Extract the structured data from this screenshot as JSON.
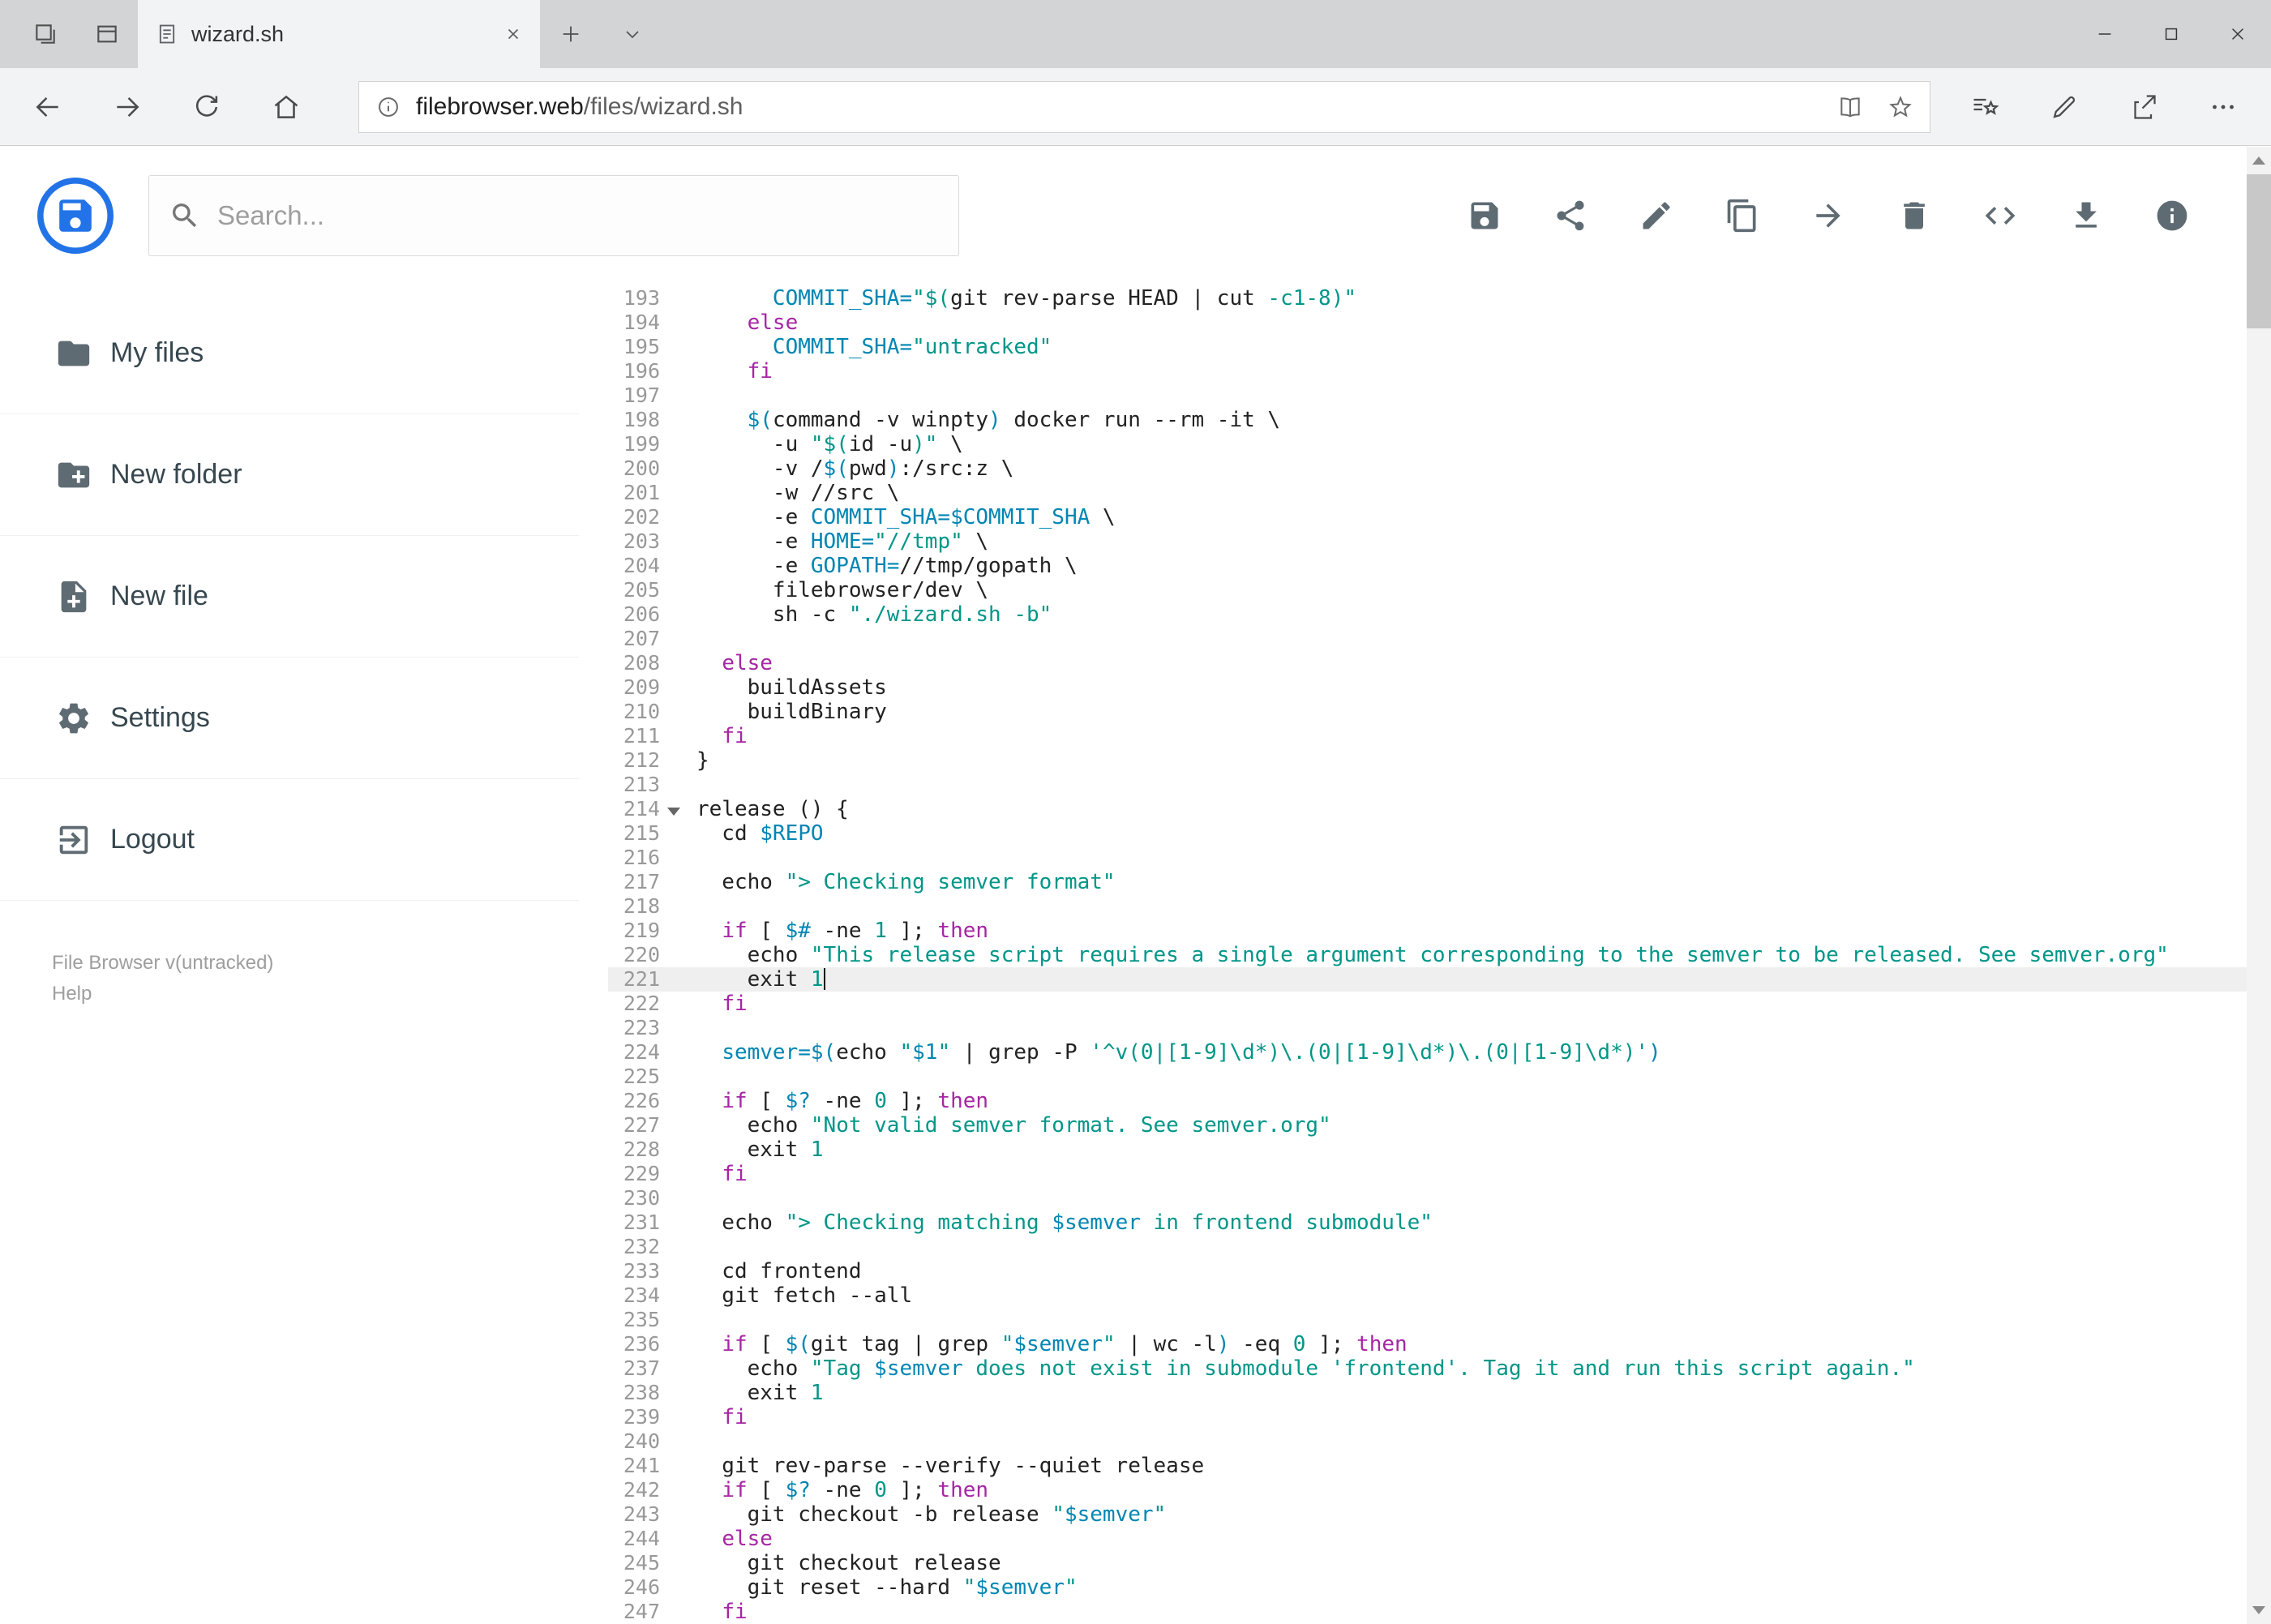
{
  "browser": {
    "tab_title": "wizard.sh",
    "url_host": "filebrowser.web",
    "url_path": "/files/wizard.sh",
    "icons": {
      "tabstrip_left": [
        "set-tabs-aside",
        "show-set-aside-tabs"
      ],
      "tab": [
        "page-favicon",
        "close-tab"
      ],
      "tabstrip_right": [
        "new-tab",
        "tab-preview-chevron"
      ],
      "window_controls": [
        "minimize",
        "maximize",
        "close"
      ],
      "nav": [
        "back",
        "forward",
        "refresh",
        "home"
      ],
      "url_field": [
        "info",
        "reading-view",
        "favorite-star"
      ],
      "toolbar_right": [
        "hub-favorites",
        "web-notes-pen",
        "share",
        "more-ellipsis"
      ]
    }
  },
  "app": {
    "search_placeholder": "Search...",
    "toolbar_icons": [
      "save",
      "share",
      "rename",
      "copy",
      "move",
      "delete",
      "code",
      "download",
      "info"
    ],
    "sidebar": {
      "items": [
        {
          "icon": "folder",
          "label": "My files"
        },
        {
          "icon": "new-folder",
          "label": "New folder"
        },
        {
          "icon": "new-file",
          "label": "New file"
        },
        {
          "icon": "settings",
          "label": "Settings"
        },
        {
          "icon": "logout",
          "label": "Logout"
        }
      ],
      "footer_version": "File Browser v(untracked)",
      "footer_help": "Help"
    }
  },
  "colors": {
    "brand": "#2273e8",
    "icon_gray": "#5f6b73",
    "code_plain": "#222222",
    "code_keyword": "#a626a4",
    "code_string": "#009688",
    "code_variable": "#0086b3",
    "code_number": "#009688",
    "line_number": "#999999",
    "active_line_bg": "#efefef"
  },
  "editor": {
    "language": "shell",
    "active_line": 221,
    "fold_marker_line": 214,
    "lines": [
      {
        "n": 193,
        "seg": [
          [
            "p",
            "      "
          ],
          [
            "v",
            "COMMIT_SHA="
          ],
          [
            "s",
            "\"$("
          ],
          [
            "p",
            "git rev-parse HEAD | cut "
          ],
          [
            "n",
            "-c1-8"
          ],
          [
            "s",
            ")\""
          ]
        ]
      },
      {
        "n": 194,
        "seg": [
          [
            "p",
            "    "
          ],
          [
            "k",
            "else"
          ]
        ]
      },
      {
        "n": 195,
        "seg": [
          [
            "p",
            "      "
          ],
          [
            "v",
            "COMMIT_SHA="
          ],
          [
            "s",
            "\"untracked\""
          ]
        ]
      },
      {
        "n": 196,
        "seg": [
          [
            "p",
            "    "
          ],
          [
            "k",
            "fi"
          ]
        ]
      },
      {
        "n": 197,
        "seg": []
      },
      {
        "n": 198,
        "seg": [
          [
            "p",
            "    "
          ],
          [
            "v",
            "$("
          ],
          [
            "p",
            "command -v winpty"
          ],
          [
            "v",
            ")"
          ],
          [
            "p",
            " docker run --rm -it \\"
          ]
        ]
      },
      {
        "n": 199,
        "seg": [
          [
            "p",
            "      -u "
          ],
          [
            "s",
            "\"$("
          ],
          [
            "p",
            "id -u"
          ],
          [
            "s",
            ")\""
          ],
          [
            "p",
            " \\"
          ]
        ]
      },
      {
        "n": 200,
        "seg": [
          [
            "p",
            "      -v /"
          ],
          [
            "v",
            "$("
          ],
          [
            "p",
            "pwd"
          ],
          [
            "v",
            ")"
          ],
          [
            "p",
            ":/src:z \\"
          ]
        ]
      },
      {
        "n": 201,
        "seg": [
          [
            "p",
            "      -w //src \\"
          ]
        ]
      },
      {
        "n": 202,
        "seg": [
          [
            "p",
            "      -e "
          ],
          [
            "v",
            "COMMIT_SHA=$COMMIT_SHA"
          ],
          [
            "p",
            " \\"
          ]
        ]
      },
      {
        "n": 203,
        "seg": [
          [
            "p",
            "      -e "
          ],
          [
            "v",
            "HOME="
          ],
          [
            "s",
            "\"//tmp\""
          ],
          [
            "p",
            " \\"
          ]
        ]
      },
      {
        "n": 204,
        "seg": [
          [
            "p",
            "      -e "
          ],
          [
            "v",
            "GOPATH="
          ],
          [
            "p",
            "//tmp/gopath \\"
          ]
        ]
      },
      {
        "n": 205,
        "seg": [
          [
            "p",
            "      filebrowser/dev \\"
          ]
        ]
      },
      {
        "n": 206,
        "seg": [
          [
            "p",
            "      sh -c "
          ],
          [
            "s",
            "\"./wizard.sh -b\""
          ]
        ]
      },
      {
        "n": 207,
        "seg": []
      },
      {
        "n": 208,
        "seg": [
          [
            "p",
            "  "
          ],
          [
            "k",
            "else"
          ]
        ]
      },
      {
        "n": 209,
        "seg": [
          [
            "p",
            "    buildAssets"
          ]
        ]
      },
      {
        "n": 210,
        "seg": [
          [
            "p",
            "    buildBinary"
          ]
        ]
      },
      {
        "n": 211,
        "seg": [
          [
            "p",
            "  "
          ],
          [
            "k",
            "fi"
          ]
        ]
      },
      {
        "n": 212,
        "seg": [
          [
            "p",
            "}"
          ]
        ]
      },
      {
        "n": 213,
        "seg": []
      },
      {
        "n": 214,
        "seg": [
          [
            "p",
            "release () {"
          ]
        ]
      },
      {
        "n": 215,
        "seg": [
          [
            "p",
            "  cd "
          ],
          [
            "v",
            "$REPO"
          ]
        ]
      },
      {
        "n": 216,
        "seg": []
      },
      {
        "n": 217,
        "seg": [
          [
            "p",
            "  echo "
          ],
          [
            "s",
            "\"> Checking semver format\""
          ]
        ]
      },
      {
        "n": 218,
        "seg": []
      },
      {
        "n": 219,
        "seg": [
          [
            "p",
            "  "
          ],
          [
            "k",
            "if"
          ],
          [
            "p",
            " [ "
          ],
          [
            "v",
            "$#"
          ],
          [
            "p",
            " -ne "
          ],
          [
            "n",
            "1"
          ],
          [
            "p",
            " ]; "
          ],
          [
            "k",
            "then"
          ]
        ]
      },
      {
        "n": 220,
        "seg": [
          [
            "p",
            "    echo "
          ],
          [
            "s",
            "\"This release script requires a single argument corresponding to the semver to be released. See semver.org\""
          ]
        ]
      },
      {
        "n": 221,
        "seg": [
          [
            "p",
            "    exit "
          ],
          [
            "n",
            "1"
          ]
        ]
      },
      {
        "n": 222,
        "seg": [
          [
            "p",
            "  "
          ],
          [
            "k",
            "fi"
          ]
        ]
      },
      {
        "n": 223,
        "seg": []
      },
      {
        "n": 224,
        "seg": [
          [
            "p",
            "  "
          ],
          [
            "v",
            "semver=$("
          ],
          [
            "p",
            "echo "
          ],
          [
            "s",
            "\""
          ],
          [
            "v",
            "$1"
          ],
          [
            "s",
            "\""
          ],
          [
            "p",
            " | grep -P "
          ],
          [
            "s",
            "'^v(0|[1-9]\\d*)\\.(0|[1-9]\\d*)\\.(0|[1-9]\\d*)'"
          ],
          [
            "v",
            ")"
          ]
        ]
      },
      {
        "n": 225,
        "seg": []
      },
      {
        "n": 226,
        "seg": [
          [
            "p",
            "  "
          ],
          [
            "k",
            "if"
          ],
          [
            "p",
            " [ "
          ],
          [
            "v",
            "$?"
          ],
          [
            "p",
            " -ne "
          ],
          [
            "n",
            "0"
          ],
          [
            "p",
            " ]; "
          ],
          [
            "k",
            "then"
          ]
        ]
      },
      {
        "n": 227,
        "seg": [
          [
            "p",
            "    echo "
          ],
          [
            "s",
            "\"Not valid semver format. See semver.org\""
          ]
        ]
      },
      {
        "n": 228,
        "seg": [
          [
            "p",
            "    exit "
          ],
          [
            "n",
            "1"
          ]
        ]
      },
      {
        "n": 229,
        "seg": [
          [
            "p",
            "  "
          ],
          [
            "k",
            "fi"
          ]
        ]
      },
      {
        "n": 230,
        "seg": []
      },
      {
        "n": 231,
        "seg": [
          [
            "p",
            "  echo "
          ],
          [
            "s",
            "\"> Checking matching "
          ],
          [
            "v",
            "$semver"
          ],
          [
            "s",
            " in frontend submodule\""
          ]
        ]
      },
      {
        "n": 232,
        "seg": []
      },
      {
        "n": 233,
        "seg": [
          [
            "p",
            "  cd frontend"
          ]
        ]
      },
      {
        "n": 234,
        "seg": [
          [
            "p",
            "  git fetch --all"
          ]
        ]
      },
      {
        "n": 235,
        "seg": []
      },
      {
        "n": 236,
        "seg": [
          [
            "p",
            "  "
          ],
          [
            "k",
            "if"
          ],
          [
            "p",
            " [ "
          ],
          [
            "v",
            "$("
          ],
          [
            "p",
            "git tag | grep "
          ],
          [
            "s",
            "\""
          ],
          [
            "v",
            "$semver"
          ],
          [
            "s",
            "\""
          ],
          [
            "p",
            " | wc -l"
          ],
          [
            "v",
            ")"
          ],
          [
            "p",
            " -eq "
          ],
          [
            "n",
            "0"
          ],
          [
            "p",
            " ]; "
          ],
          [
            "k",
            "then"
          ]
        ]
      },
      {
        "n": 237,
        "seg": [
          [
            "p",
            "    echo "
          ],
          [
            "s",
            "\"Tag "
          ],
          [
            "v",
            "$semver"
          ],
          [
            "s",
            " does not exist in submodule 'frontend'. Tag it and run this script again.\""
          ]
        ]
      },
      {
        "n": 238,
        "seg": [
          [
            "p",
            "    exit "
          ],
          [
            "n",
            "1"
          ]
        ]
      },
      {
        "n": 239,
        "seg": [
          [
            "p",
            "  "
          ],
          [
            "k",
            "fi"
          ]
        ]
      },
      {
        "n": 240,
        "seg": []
      },
      {
        "n": 241,
        "seg": [
          [
            "p",
            "  git rev-parse --verify --quiet release"
          ]
        ]
      },
      {
        "n": 242,
        "seg": [
          [
            "p",
            "  "
          ],
          [
            "k",
            "if"
          ],
          [
            "p",
            " [ "
          ],
          [
            "v",
            "$?"
          ],
          [
            "p",
            " -ne "
          ],
          [
            "n",
            "0"
          ],
          [
            "p",
            " ]; "
          ],
          [
            "k",
            "then"
          ]
        ]
      },
      {
        "n": 243,
        "seg": [
          [
            "p",
            "    git checkout -b release "
          ],
          [
            "s",
            "\""
          ],
          [
            "v",
            "$semver"
          ],
          [
            "s",
            "\""
          ]
        ]
      },
      {
        "n": 244,
        "seg": [
          [
            "p",
            "  "
          ],
          [
            "k",
            "else"
          ]
        ]
      },
      {
        "n": 245,
        "seg": [
          [
            "p",
            "    git checkout release"
          ]
        ]
      },
      {
        "n": 246,
        "seg": [
          [
            "p",
            "    git reset --hard "
          ],
          [
            "s",
            "\""
          ],
          [
            "v",
            "$semver"
          ],
          [
            "s",
            "\""
          ]
        ]
      },
      {
        "n": 247,
        "seg": [
          [
            "p",
            "  "
          ],
          [
            "k",
            "fi"
          ]
        ]
      }
    ]
  }
}
